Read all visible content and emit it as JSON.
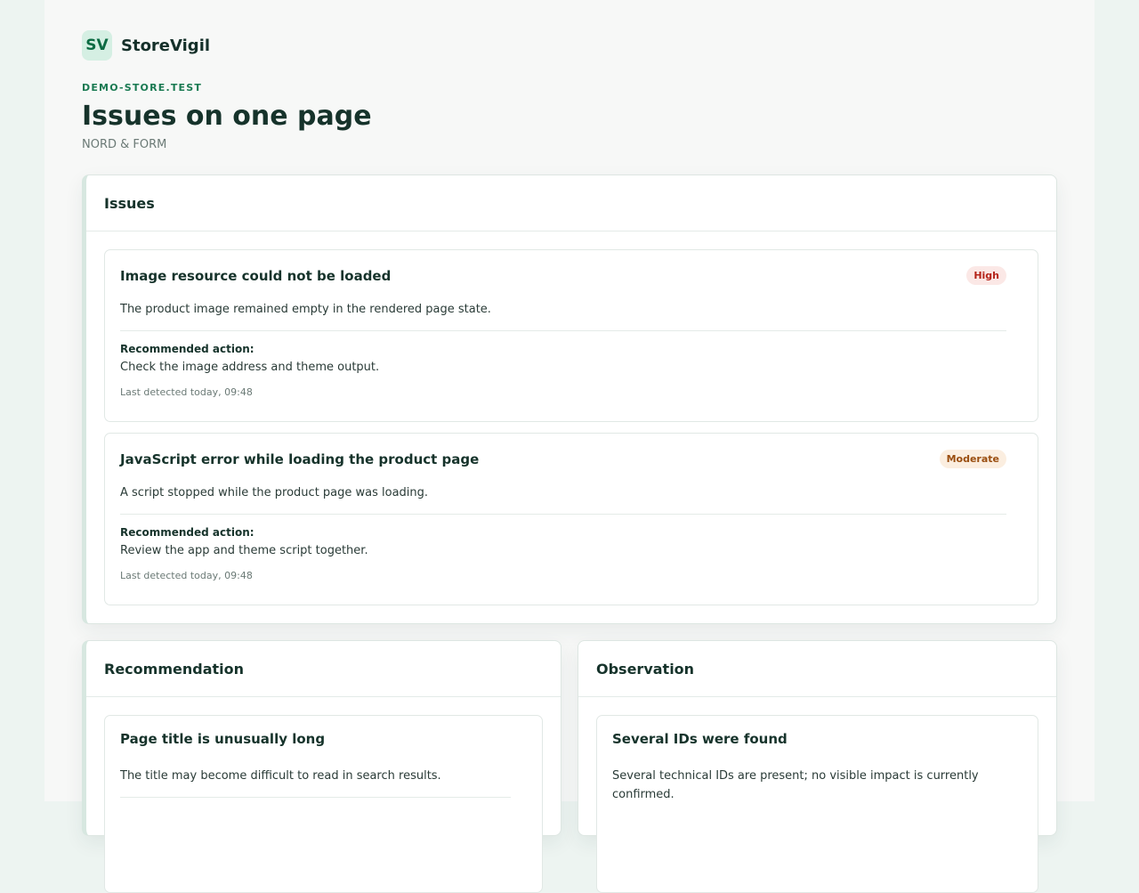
{
  "brand": {
    "logo_text": "SV",
    "name": "StoreVigil"
  },
  "header": {
    "domain": "DEMO-STORE.TEST",
    "title": "Issues on one page",
    "subtitle": "NORD & FORM"
  },
  "issues_panel": {
    "heading": "Issues",
    "items": [
      {
        "title": "Image resource could not be loaded",
        "severity": "High",
        "description": "The product image remained empty in the rendered page state.",
        "action_label": "Recommended action:",
        "action": "Check the image address and theme output.",
        "detected": "Last detected today, 09:48"
      },
      {
        "title": "JavaScript error while loading the product page",
        "severity": "Moderate",
        "description": "A script stopped while the product page was loading.",
        "action_label": "Recommended action:",
        "action": "Review the app and theme script together.",
        "detected": "Last detected today, 09:48"
      }
    ]
  },
  "recommendation_panel": {
    "heading": "Recommendation",
    "item": {
      "title": "Page title is unusually long",
      "description": "The title may become difficult to read in search results."
    }
  },
  "observation_panel": {
    "heading": "Observation",
    "item": {
      "title": "Several IDs were found",
      "description": "Several technical IDs are present; no visible impact is currently confirmed."
    }
  },
  "colors": {
    "accent": "#1a7a52",
    "high": "#b42319",
    "moderate": "#9a4e10"
  }
}
